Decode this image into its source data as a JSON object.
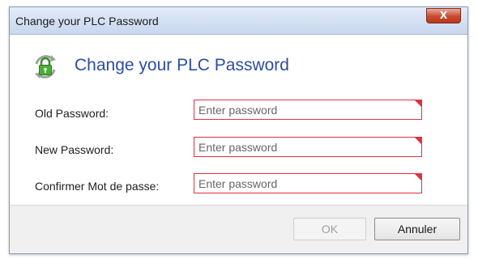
{
  "window": {
    "title": "Change your PLC Password",
    "close_label": "X"
  },
  "header": {
    "icon": "lock-refresh-icon",
    "heading": "Change your PLC Password",
    "heading_color": "#2b4da0"
  },
  "form": {
    "old_password": {
      "label": "Old Password:",
      "placeholder": "Enter password",
      "value": ""
    },
    "new_password": {
      "label": "New Password:",
      "placeholder": "Enter password",
      "value": ""
    },
    "confirm_password": {
      "label": "Confirmer Mot de passe:",
      "placeholder": "Enter password",
      "value": ""
    },
    "error_color": "#e0313e"
  },
  "buttons": {
    "ok_label": "OK",
    "ok_enabled": false,
    "cancel_label": "Annuler"
  }
}
